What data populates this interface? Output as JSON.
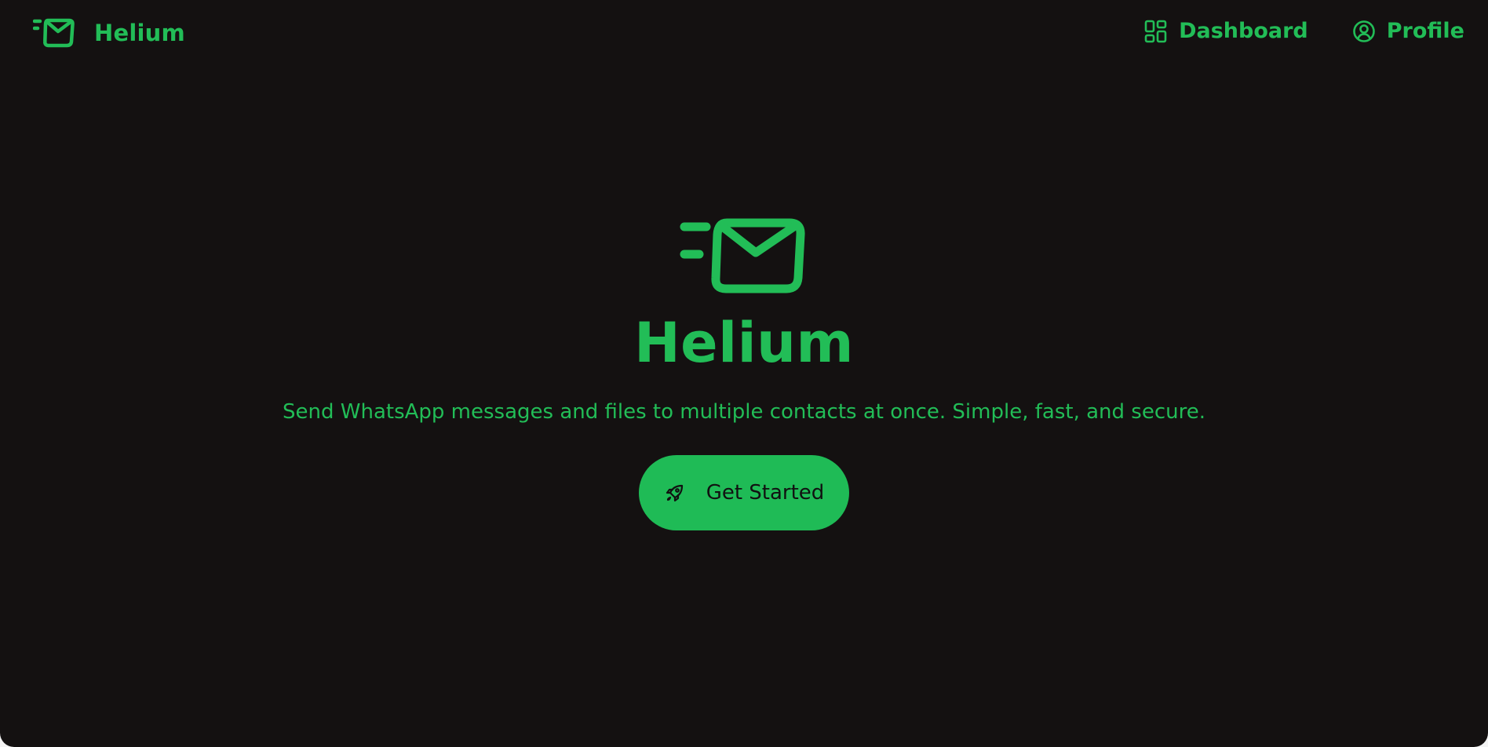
{
  "app": {
    "name": "Helium"
  },
  "nav": {
    "links": [
      {
        "label": "Dashboard",
        "icon": "dashboard-grid-icon"
      },
      {
        "label": "Profile",
        "icon": "user-circle-icon"
      }
    ]
  },
  "hero": {
    "title": "Helium",
    "subtitle": "Send WhatsApp messages and files to multiple contacts at once. Simple, fast, and secure.",
    "cta_label": "Get Started",
    "cta_icon": "rocket-icon",
    "logo_icon": "fast-mail-icon"
  },
  "colors": {
    "background": "#141111",
    "accent": "#22bd57",
    "button": "#1fbb56",
    "button_text": "#111111"
  }
}
